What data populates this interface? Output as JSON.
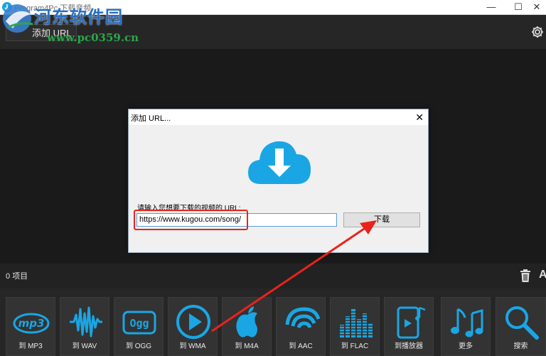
{
  "window": {
    "title": "Program4Pc 下载音频",
    "controls": {
      "minimize": "—",
      "maximize": "☐",
      "close": "✕"
    }
  },
  "watermark": {
    "text": "河东软件园",
    "url": "www.pc0359.cn"
  },
  "toolbar": {
    "add_url_label": "添加 URL"
  },
  "dialog": {
    "title": "添加 URL...",
    "close": "✕",
    "prompt": "请输入您想要下载的视频的 URL:",
    "url_value": "https://www.kugou.com/song/",
    "download_label": "下载"
  },
  "status": {
    "item_count": "0 项目",
    "partial": "A"
  },
  "tiles": [
    {
      "label": "到 MP3",
      "icon": "mp3-icon"
    },
    {
      "label": "到 WAV",
      "icon": "waveform-icon"
    },
    {
      "label": "到 OGG",
      "icon": "ogg-icon"
    },
    {
      "label": "到 WMA",
      "icon": "play-icon"
    },
    {
      "label": "到 M4A",
      "icon": "apple-icon"
    },
    {
      "label": "到 AAC",
      "icon": "aac-icon"
    },
    {
      "label": "到 FLAC",
      "icon": "equalizer-icon"
    },
    {
      "label": "到播放器",
      "icon": "phone-music-icon"
    },
    {
      "label": "更多",
      "icon": "music-notes-icon"
    },
    {
      "label": "搜索",
      "icon": "search-icon"
    }
  ],
  "colors": {
    "accent": "#1aa6e4",
    "annotation_red": "#e8231c",
    "background": "#1a1a1a",
    "tile": "#333333"
  }
}
